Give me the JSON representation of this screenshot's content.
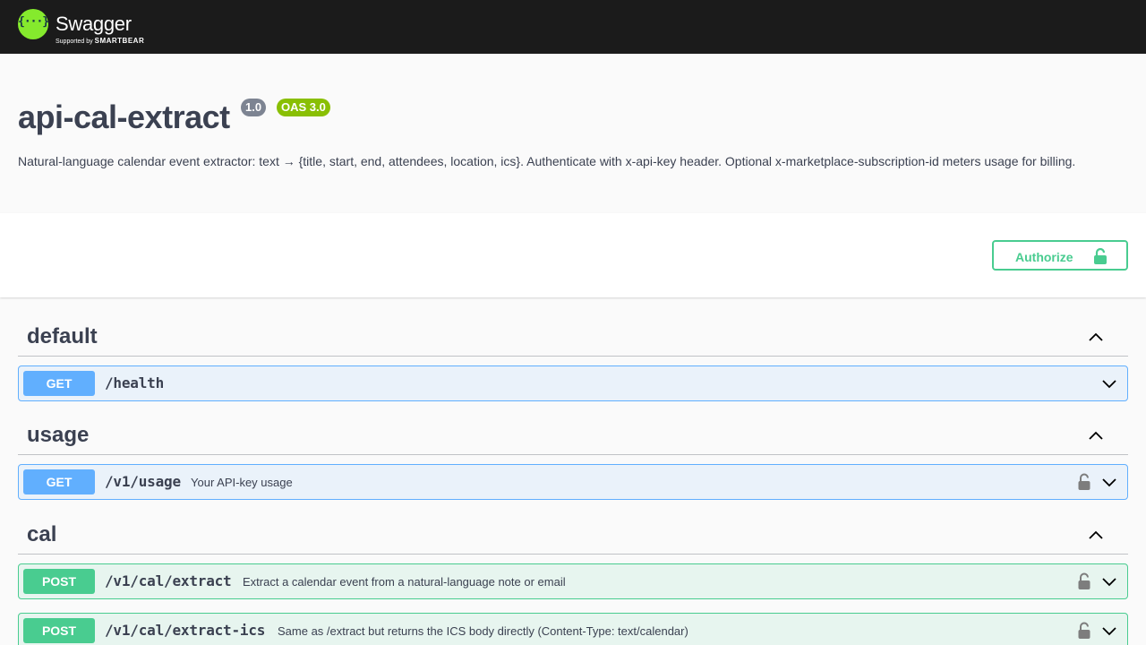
{
  "topbar": {
    "logo_glyph": "{···}",
    "brand_name": "Swagger",
    "brand_sub_prefix": "Supported by",
    "brand_sub_company": "SMARTBEAR",
    "logo_color": "#85ea2d"
  },
  "info": {
    "title": "api-cal-extract",
    "version": "1.0",
    "oas": "OAS 3.0",
    "description": "Natural-language calendar event extractor: text → {title, start, end, attendees, location, ics}. Authenticate with x-api-key header. Optional x-marketplace-subscription-id meters usage for billing."
  },
  "auth": {
    "label": "Authorize",
    "icon": "unlocked-lock-icon",
    "color": "#49cc90"
  },
  "tags": [
    {
      "name": "default",
      "toggle_icon": "chevron-up-icon",
      "operations": [
        {
          "method": "GET",
          "path": "/health",
          "summary": "",
          "locked": false
        }
      ]
    },
    {
      "name": "usage",
      "toggle_icon": "chevron-up-icon",
      "operations": [
        {
          "method": "GET",
          "path": "/v1/usage",
          "summary": "Your API-key usage",
          "locked": true
        }
      ]
    },
    {
      "name": "cal",
      "toggle_icon": "chevron-up-icon",
      "operations": [
        {
          "method": "POST",
          "path": "/v1/cal/extract",
          "summary": "Extract a calendar event from a natural-language note or email",
          "locked": true
        },
        {
          "method": "POST",
          "path": "/v1/cal/extract-ics",
          "summary": "Same as /extract but returns the ICS body directly (Content-Type: text/calendar)",
          "locked": true
        }
      ]
    }
  ],
  "colors": {
    "get": "#61affe",
    "post": "#49cc90",
    "badge_version": "#7d8492",
    "badge_oas": "#89bf04"
  }
}
